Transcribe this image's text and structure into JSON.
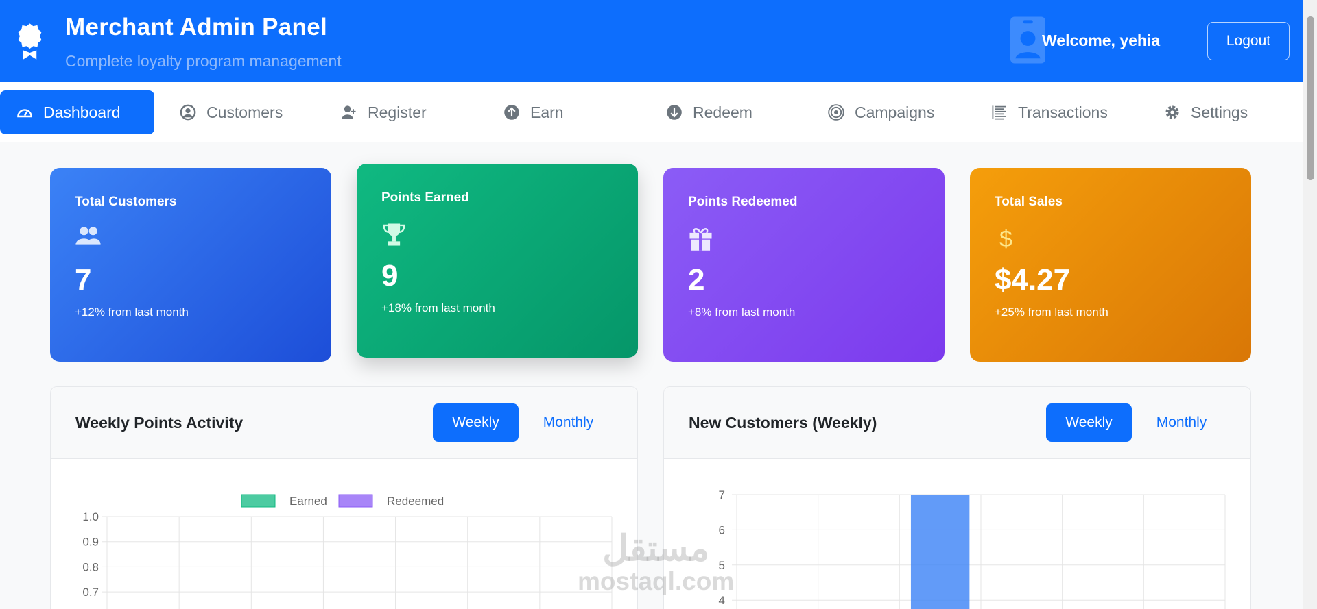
{
  "header": {
    "title": "Merchant Admin Panel",
    "subtitle": "Complete loyalty program management",
    "welcome": "Welcome, yehia",
    "logout": "Logout"
  },
  "nav": [
    {
      "label": "Dashboard",
      "icon": "gauge-icon"
    },
    {
      "label": "Customers",
      "icon": "user-circle-icon"
    },
    {
      "label": "Register",
      "icon": "user-plus-icon"
    },
    {
      "label": "Earn",
      "icon": "arrow-up-circle-icon"
    },
    {
      "label": "Redeem",
      "icon": "arrow-down-circle-icon"
    },
    {
      "label": "Campaigns",
      "icon": "bullseye-icon"
    },
    {
      "label": "Transactions",
      "icon": "list-icon"
    },
    {
      "label": "Settings",
      "icon": "gear-icon"
    }
  ],
  "stats": [
    {
      "label": "Total Customers",
      "value": "7",
      "change": "+12% from last month",
      "icon": "users-icon"
    },
    {
      "label": "Points Earned",
      "value": "9",
      "change": "+18% from last month",
      "icon": "trophy-icon"
    },
    {
      "label": "Points Redeemed",
      "value": "2",
      "change": "+8% from last month",
      "icon": "gift-icon"
    },
    {
      "label": "Total Sales",
      "value": "$4.27",
      "change": "+25% from last month",
      "icon": "dollar-icon"
    }
  ],
  "panels": [
    {
      "title": "Weekly Points Activity",
      "weekly": "Weekly",
      "monthly": "Monthly"
    },
    {
      "title": "New Customers (Weekly)",
      "weekly": "Weekly",
      "monthly": "Monthly"
    }
  ],
  "watermark": {
    "arabic": "مستقل",
    "latin": "mostaql.com"
  },
  "colors": {
    "primary": "#0d6efd",
    "earned": "#10b981",
    "redeemed": "#8b5cf6",
    "customers_bar": "#3b82f6"
  },
  "chart_data": [
    {
      "type": "bar",
      "title": "Weekly Points Activity",
      "series": [
        {
          "name": "Earned",
          "values": [
            0,
            0,
            0,
            0,
            0,
            0,
            0
          ]
        },
        {
          "name": "Redeemed",
          "values": [
            0,
            0,
            0,
            0,
            0,
            0,
            0
          ]
        }
      ],
      "yticks": [
        "1.0",
        "0.9",
        "0.8",
        "0.7"
      ],
      "ylim": [
        0,
        1
      ],
      "legend": "top",
      "grid": true
    },
    {
      "type": "bar",
      "title": "New Customers (Weekly)",
      "values": [
        0,
        0,
        7,
        0,
        0,
        0
      ],
      "yticks": [
        "7",
        "6",
        "5",
        "4"
      ],
      "ylim": [
        0,
        7
      ],
      "grid": true
    }
  ]
}
